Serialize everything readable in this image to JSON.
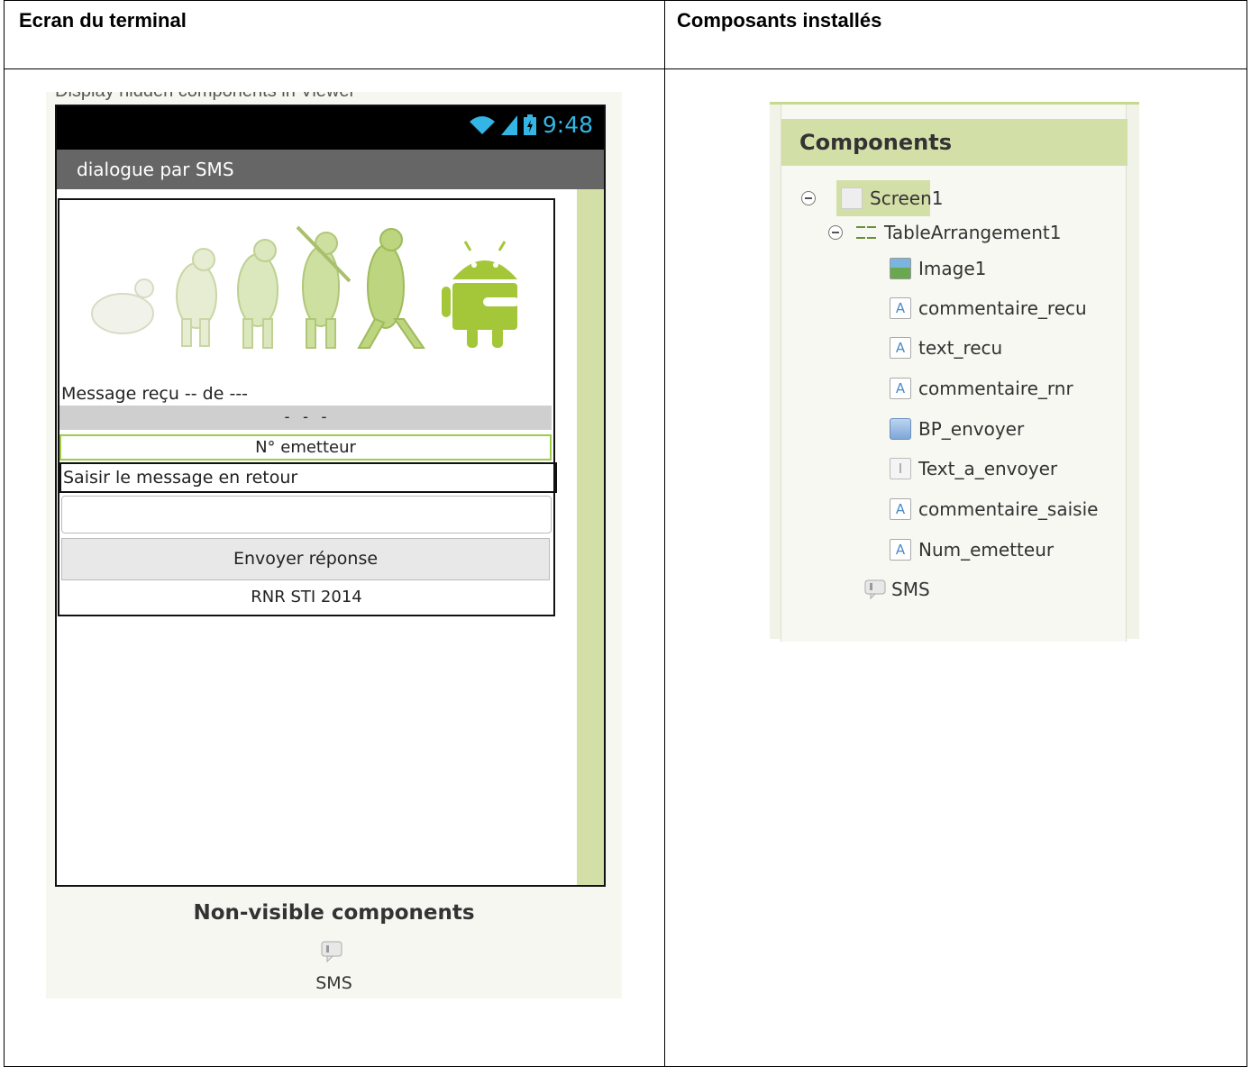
{
  "headers": {
    "left": "Ecran du terminal",
    "right": "Composants installés"
  },
  "viewer": {
    "cut_text": "Display hidden components in Viewer",
    "status_time": "9:48",
    "app_title": "dialogue par SMS",
    "message_label": "Message reçu -- de ---",
    "text_recu": "- - -",
    "num_emetteur": "N° emetteur",
    "commentaire_saisie": "Saisir le message en retour",
    "text_a_envoyer_value": "",
    "button_label": "Envoyer réponse",
    "commentaire_rnr": "RNR STI 2014",
    "nonvisible_title": "Non-visible components",
    "nonvisible_item": "SMS"
  },
  "components": {
    "title": "Components",
    "screen": "Screen1",
    "table": "TableArrangement1",
    "items": [
      {
        "label": "Image1",
        "icon": "image-icon"
      },
      {
        "label": "commentaire_recu",
        "icon": "label-icon"
      },
      {
        "label": "text_recu",
        "icon": "label-icon"
      },
      {
        "label": "commentaire_rnr",
        "icon": "label-icon"
      },
      {
        "label": "BP_envoyer",
        "icon": "button-icon"
      },
      {
        "label": "Text_a_envoyer",
        "icon": "textbox-icon"
      },
      {
        "label": "commentaire_saisie",
        "icon": "label-icon"
      },
      {
        "label": "Num_emetteur",
        "icon": "label-icon"
      }
    ],
    "nonvisible": "SMS",
    "label_glyph": "A",
    "textbox_glyph": "I"
  },
  "colors": {
    "accent_green": "#d2e0a8",
    "status_blue": "#33b5e5",
    "titlebar_gray": "#666666"
  }
}
